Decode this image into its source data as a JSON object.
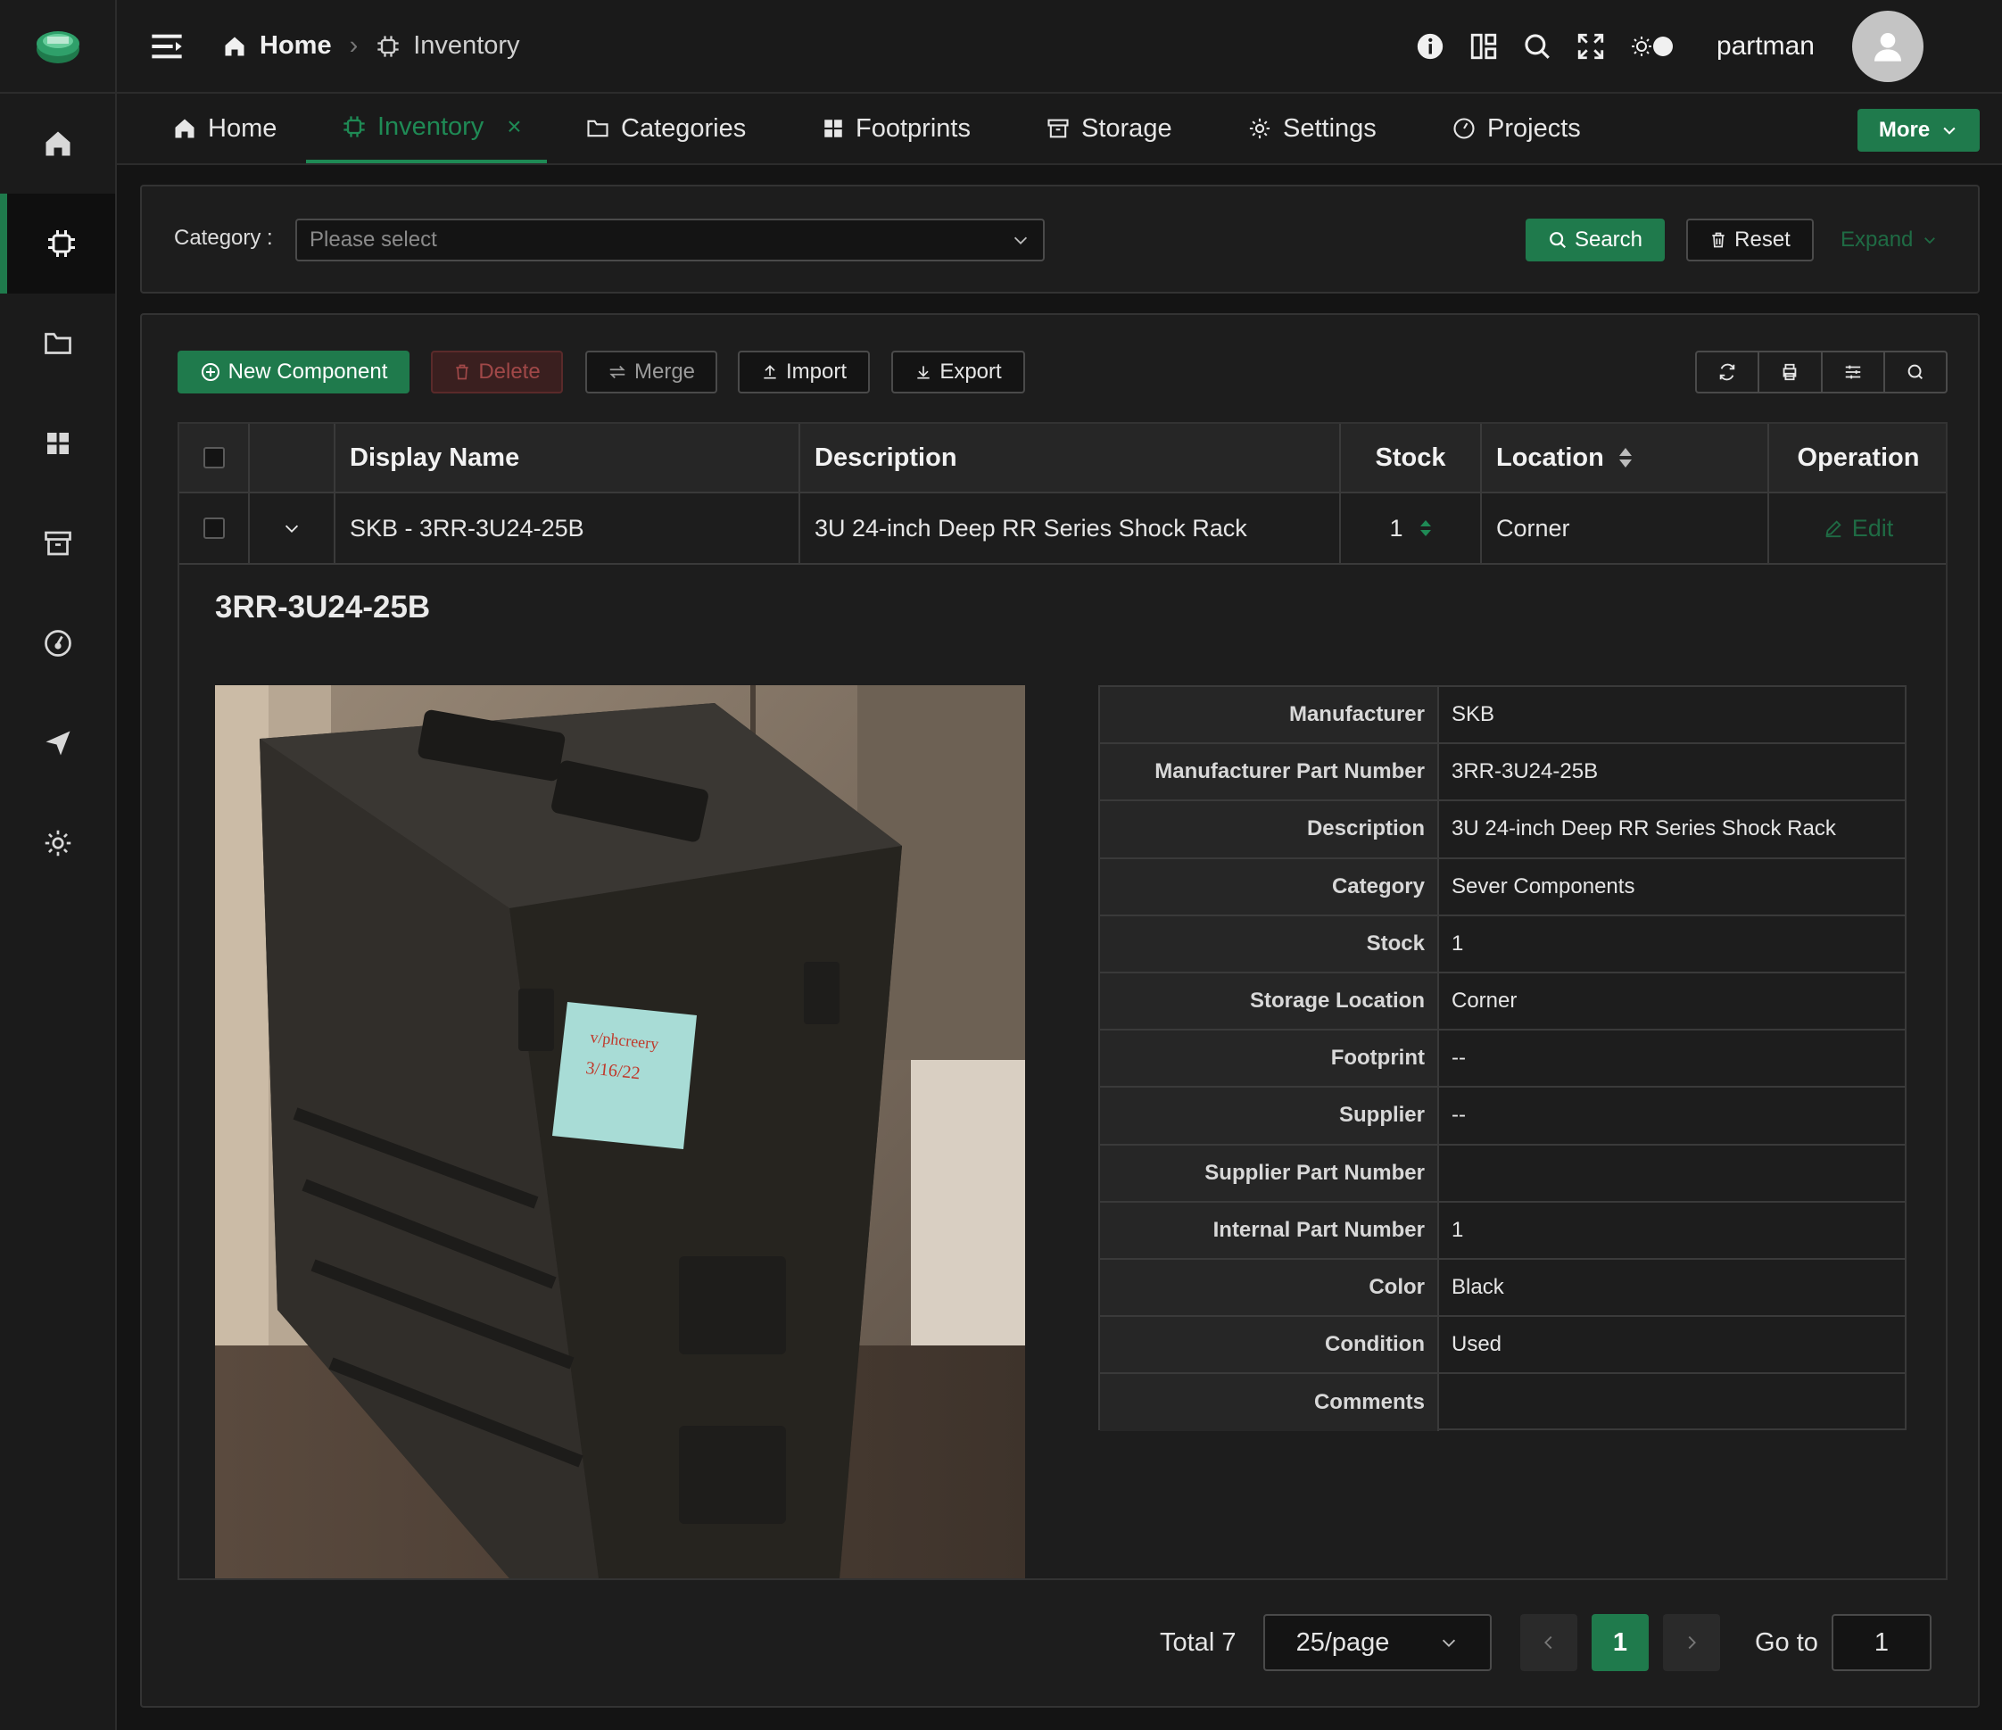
{
  "header": {
    "breadcrumb_home": "Home",
    "breadcrumb_current": "Inventory",
    "username": "partman"
  },
  "tabs": [
    {
      "label": "Home",
      "icon": "home-icon"
    },
    {
      "label": "Inventory",
      "icon": "chip-icon",
      "active": true
    },
    {
      "label": "Categories",
      "icon": "folder-icon"
    },
    {
      "label": "Footprints",
      "icon": "grid-icon"
    },
    {
      "label": "Storage",
      "icon": "archive-icon"
    },
    {
      "label": "Settings",
      "icon": "gear-icon"
    },
    {
      "label": "Projects",
      "icon": "gauge-icon"
    }
  ],
  "more_label": "More",
  "filter": {
    "category_label": "Category :",
    "category_placeholder": "Please select",
    "search_label": "Search",
    "reset_label": "Reset",
    "expand_label": "Expand"
  },
  "toolbar": {
    "new_label": "New Component",
    "delete_label": "Delete",
    "merge_label": "Merge",
    "import_label": "Import",
    "export_label": "Export"
  },
  "table": {
    "columns": [
      "Display Name",
      "Description",
      "Stock",
      "Location",
      "Operation"
    ],
    "rows": [
      {
        "display_name": "SKB - 3RR-3U24-25B",
        "description": "3U 24-inch Deep RR Series Shock Rack",
        "stock": "1",
        "location": "Corner",
        "operation": "Edit"
      }
    ]
  },
  "detail": {
    "title": "3RR-3U24-25B",
    "photo_note_line1": "v/phcreery",
    "photo_note_line2": "3/16/22",
    "fields": [
      {
        "label": "Manufacturer",
        "value": "SKB"
      },
      {
        "label": "Manufacturer Part Number",
        "value": "3RR-3U24-25B"
      },
      {
        "label": "Description",
        "value": "3U 24-inch Deep RR Series Shock Rack"
      },
      {
        "label": "Category",
        "value": "Sever Components"
      },
      {
        "label": "Stock",
        "value": "1"
      },
      {
        "label": "Storage Location",
        "value": "Corner"
      },
      {
        "label": "Footprint",
        "value": "--"
      },
      {
        "label": "Supplier",
        "value": "--"
      },
      {
        "label": "Supplier Part Number",
        "value": ""
      },
      {
        "label": "Internal Part Number",
        "value": "1"
      },
      {
        "label": "Color",
        "value": "Black"
      },
      {
        "label": "Condition",
        "value": "Used"
      },
      {
        "label": "Comments",
        "value": ""
      }
    ]
  },
  "pagination": {
    "total": "Total 7",
    "page_size": "25/page",
    "current_page": "1",
    "goto_label": "Go to",
    "goto_value": "1"
  },
  "colors": {
    "accent": "#1f7a4c",
    "background": "#141414",
    "panel": "#1d1d1d"
  }
}
